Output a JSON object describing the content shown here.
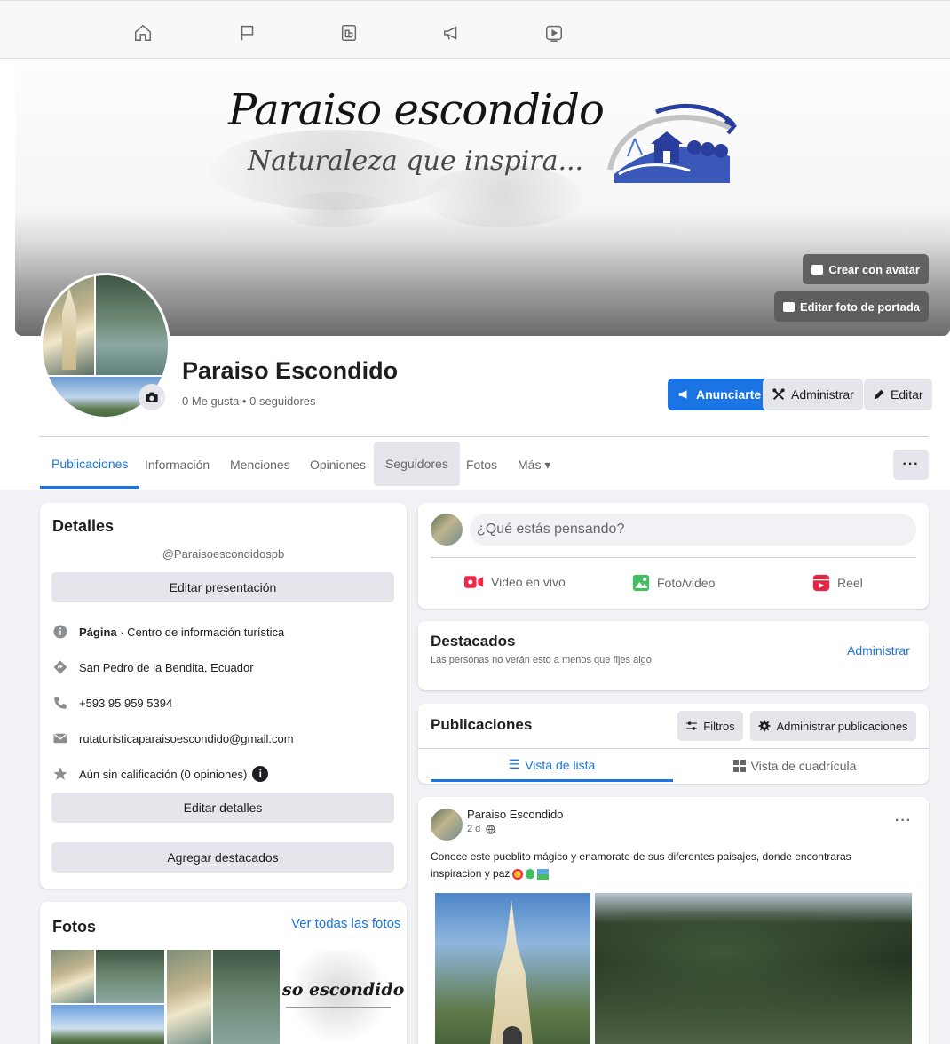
{
  "nav": {
    "icons": [
      "home-icon",
      "flag-icon",
      "pages-icon",
      "megaphone-icon",
      "video-icon"
    ]
  },
  "cover": {
    "title_text": "Paraiso escondido",
    "subtitle_text": "Naturaleza que inspira...",
    "create_avatar_label": "Crear con avatar",
    "edit_cover_label": "Editar foto de portada"
  },
  "profile": {
    "name": "Paraiso Escondido",
    "stats": "0 Me gusta • 0 seguidores",
    "promote_label": "Anunciarte",
    "manage_label": "Administrar",
    "edit_label": "Editar",
    "accent_color": "#1b74e4"
  },
  "tabs": [
    {
      "label": "Publicaciones"
    },
    {
      "label": "Información"
    },
    {
      "label": "Menciones"
    },
    {
      "label": "Opiniones"
    },
    {
      "label": "Seguidores"
    },
    {
      "label": "Fotos"
    },
    {
      "label": "Más ▾"
    }
  ],
  "more_label": "···",
  "details": {
    "title": "Detalles",
    "username": "@Paraisoescondidospb",
    "edit_intro_label": "Editar presentación",
    "page_type_bold": "Página",
    "page_type_rest": " · Centro de información turística",
    "location": "San Pedro de la Bendita, Ecuador",
    "phone": "+593 95 959 5394",
    "email": "rutaturisticaparaisoescondido@gmail.com",
    "rating": "Aún sin calificación (0 opiniones)",
    "edit_details_label": "Editar detalles",
    "add_featured_label": "Agregar destacados"
  },
  "photos": {
    "title": "Fotos",
    "see_all_label": "Ver todas las fotos",
    "thumb_text": "so escondido"
  },
  "composer": {
    "placeholder": "¿Qué estás pensando?",
    "live_label": "Video en vivo",
    "photo_label": "Foto/video",
    "reel_label": "Reel"
  },
  "featured": {
    "title": "Destacados",
    "note": "Las personas no verán esto a menos que fijes algo.",
    "manage_label": "Administrar"
  },
  "posts_header": {
    "title": "Publicaciones",
    "filters_label": "Filtros",
    "manage_posts_label": "Administrar publicaciones",
    "list_view_label": "Vista de lista",
    "grid_view_label": "Vista de cuadrícula"
  },
  "post": {
    "author": "Paraiso Escondido",
    "time": "2 d",
    "text_line1": "Conoce este pueblito mágico y enamorate de sus diferentes paisajes, donde encontraras",
    "text_line2": "inspiracion y paz",
    "more_label": "···"
  }
}
